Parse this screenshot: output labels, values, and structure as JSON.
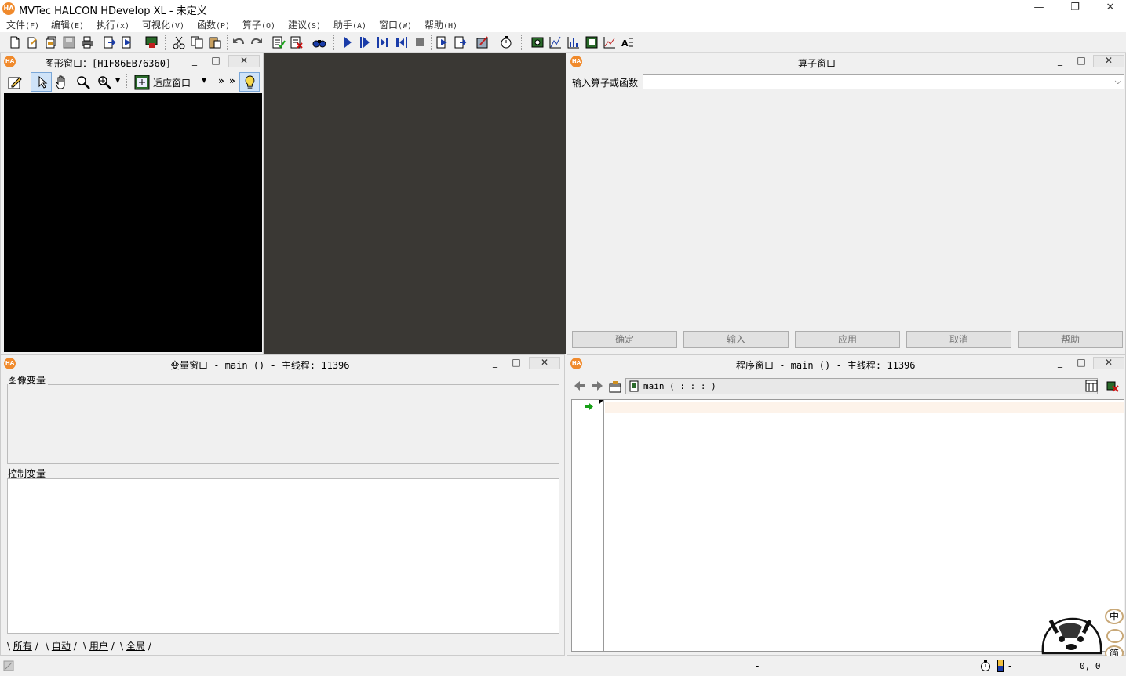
{
  "app": {
    "title": "MVTec HALCON HDevelop XL - 未定义",
    "logo_text": "HA",
    "controls": {
      "minimize": "—",
      "restore": "❐",
      "close": "✕"
    }
  },
  "menu": [
    {
      "label": "文件",
      "acc": "(F)"
    },
    {
      "label": "编辑",
      "acc": "(E)"
    },
    {
      "label": "执行",
      "acc": "(x)"
    },
    {
      "label": "可视化",
      "acc": "(V)"
    },
    {
      "label": "函数",
      "acc": "(P)"
    },
    {
      "label": "算子",
      "acc": "(O)"
    },
    {
      "label": "建议",
      "acc": "(S)"
    },
    {
      "label": "助手",
      "acc": "(A)"
    },
    {
      "label": "窗口",
      "acc": "(W)"
    },
    {
      "label": "帮助",
      "acc": "(H)"
    }
  ],
  "graphics_window": {
    "title": "图形窗口：[H1F86EB76360]",
    "fit_label": "适应窗口",
    "more": "»",
    "canvas_color": "#000000"
  },
  "operator_window": {
    "title": "算子窗口",
    "input_label": "输入算子或函数",
    "input_value": "",
    "buttons": [
      "确定",
      "输入",
      "应用",
      "取消",
      "帮助"
    ]
  },
  "variable_window": {
    "title": "变量窗口 - main () - 主线程: 11396",
    "image_group": "图像变量",
    "control_group": "控制变量",
    "tabs": [
      "所有",
      "自动",
      "用户",
      "全局"
    ]
  },
  "program_window": {
    "title": "程序窗口 - main () - 主线程: 11396",
    "procedure": "main ( : : : )"
  },
  "status": {
    "dash1": "-",
    "dash2": "-",
    "coords": "0, 0"
  },
  "ime": {
    "lang": "中",
    "mode": "简"
  },
  "colors": {
    "accent_orange": "#f08a2c",
    "dark_area": "#3a3834",
    "pc_arrow": "#18a018",
    "current_line": "#fdf3ea"
  }
}
